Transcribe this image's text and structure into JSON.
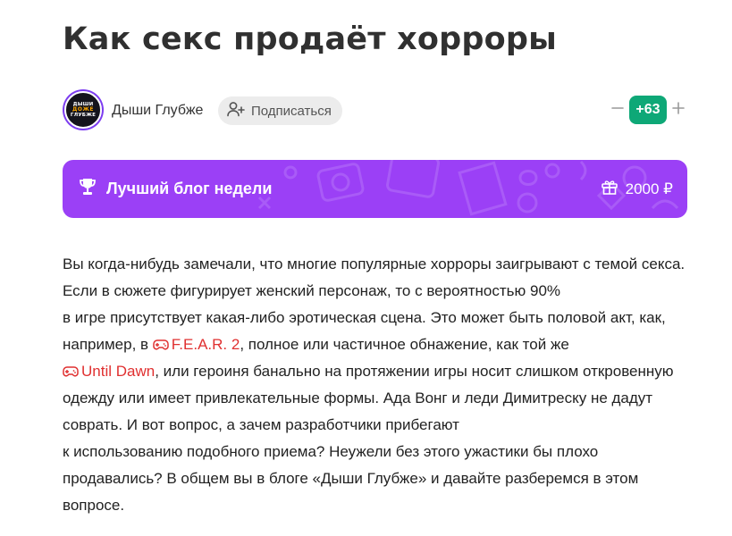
{
  "article": {
    "title": "Как секс продаёт хорроры",
    "author": {
      "name": "Дыши Глубже",
      "avatar_text": [
        "ДЫШИ",
        "ДОЖЕ",
        "ГЛУБЖЕ"
      ]
    },
    "subscribe_label": "Подписаться",
    "votes": {
      "count": "+63",
      "minus": "−",
      "plus": "+"
    },
    "banner": {
      "title": "Лучший блог недели",
      "prize": "2000 ₽",
      "color": "#9b40f6"
    },
    "body": {
      "t1": "Вы когда-нибудь замечали, что многие популярные хорроры заигрывают с темой секса. Если в сюжете фигурирует женский персонаж, то с вероятностью 90%",
      "t2": "в игре присутствует какая-либо эротическая сцена. Это может быть половой акт, как, например, в ",
      "link1": "F.E.A.R. 2",
      "t3": ", полное или частичное обнажение, как той же",
      "link2": "Until Dawn",
      "t4": ", или героиня банально на протяжении игры носит слишком откровенную одежду или имеет привлекательные формы. Ада Вонг и леди Димитреску не дадут соврать. И вот вопрос, а зачем разработчики прибегают",
      "t5": "к использованию подобного приема? Неужели без этого ужастики бы плохо продавались? В общем вы в блоге «Дыши Глубже» и давайте разберемся в этом вопросе."
    },
    "colors": {
      "accent_green": "#0ea877",
      "link_red": "#e03030"
    }
  }
}
